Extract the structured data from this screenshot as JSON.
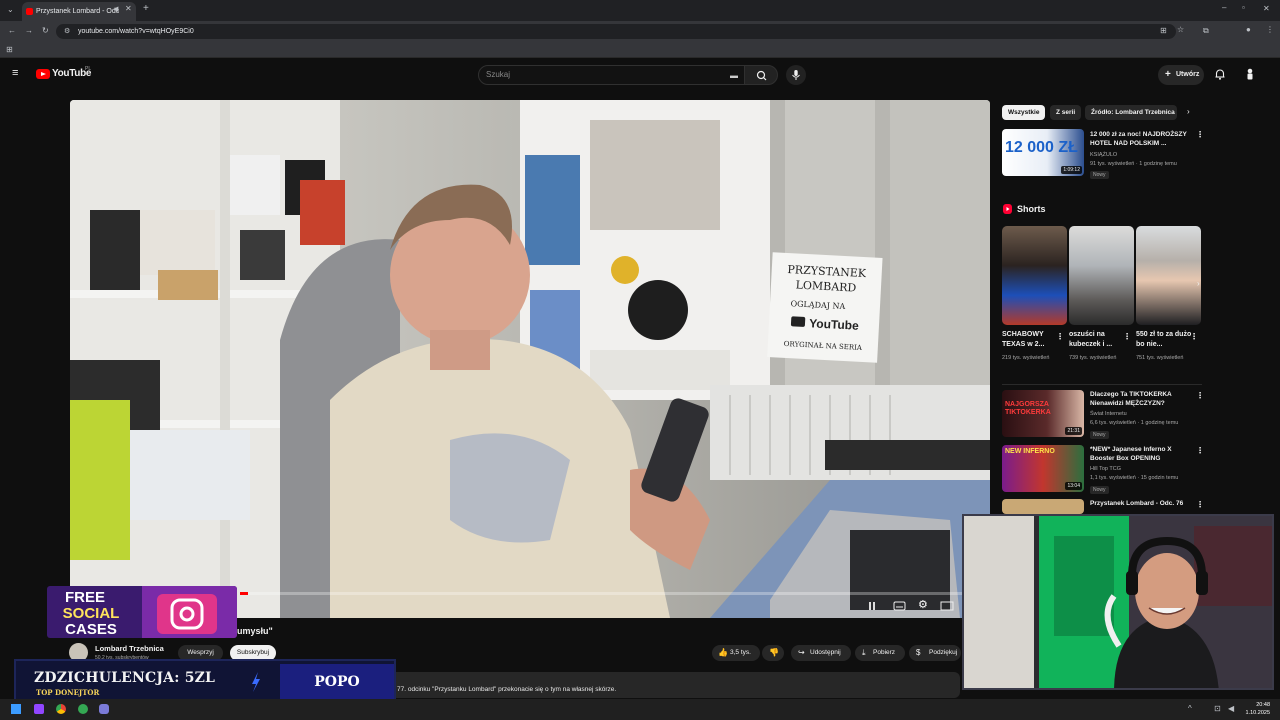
{
  "browser": {
    "tab_title": "Przystanek Lombard - Odc",
    "url": "youtube.com/watch?v=wtqHOyE9Ci0"
  },
  "youtube": {
    "logo_text": "YouTube",
    "country": "PL",
    "search_placeholder": "Szukaj",
    "create_label": "Utwórz"
  },
  "video": {
    "sign_line1": "PRZYSTANEK",
    "sign_line2": "LOMBARD",
    "sign_line3": "OGLĄDAJ NA",
    "sign_line4": "YouTube",
    "sign_line5": "ORYGINAŁ NA SERIA",
    "progress_fraction": 0.01,
    "title_fragment": "umysłu\""
  },
  "channel": {
    "name": "Lombard Trzebnica",
    "subscribers": "50,2 tys. subskrybentów",
    "support_label": "Wesprzyj",
    "subscribe_label": "Subskrybuj"
  },
  "actions": {
    "likes": "3,5 tys.",
    "share": "Udostępnij",
    "download": "Pobierz",
    "thanks": "Podziękuj"
  },
  "description": "77. odcinku \"Przystanku Lombard\" przekonacie się o tym na własnej skórze.",
  "sidebar": {
    "chips": [
      "Wszystkie",
      "Z serii",
      "Źródło: Lombard Trzebnica"
    ],
    "top_video": {
      "thumb_text": "12 000 ZŁ",
      "title": "12 000 zł za noc! NAJDROŻSZY HOTEL NAD POLSKIM ...",
      "channel": "KSIĄŻULO",
      "meta": "91 tys. wyświetleń · 1 godzinę temu",
      "badge": "Nowy",
      "duration": "1:09:12"
    },
    "shorts_label": "Shorts",
    "shorts": [
      {
        "title": "SCHABOWY TEXAS w 2...",
        "views": "219 tys. wyświetleń"
      },
      {
        "title": "oszuści na kubeczek i ...",
        "views": "739 tys. wyświetleń"
      },
      {
        "title": "550 zł to za dużo bo nie...",
        "views": "751 tys. wyświetleń"
      }
    ],
    "videos": [
      {
        "thumb_text": "NAJGORSZA TIKTOKERKA",
        "title": "Dlaczego Ta TIKTOKERKA Nienawidzi MĘŻCZYZN?",
        "channel": "Świat Internetu",
        "meta": "6,6 tys. wyświetleń · 1 godzinę temu",
        "badge": "Nowy",
        "duration": "21:31"
      },
      {
        "thumb_text": "NEW INFERNO",
        "title": "*NEW* Japanese Inferno X Booster Box OPENING",
        "channel": "Hill Top TCG",
        "meta": "1,1 tys. wyświetleń · 15 godzin temu",
        "badge": "Nowy",
        "duration": "13:04"
      },
      {
        "title": "Przystanek Lombard - Odc. 76"
      }
    ]
  },
  "overlays": {
    "promo_line1": "FREE",
    "promo_line2": "SOCIAL",
    "promo_line3": "CASES",
    "donate_text": "ZDZICHULENCJA: 5ZL",
    "donate_sub": "TOP DONEJTOR",
    "donate_right": "POPO"
  },
  "taskbar": {
    "time": "20:48",
    "date": "1.10.2025"
  }
}
